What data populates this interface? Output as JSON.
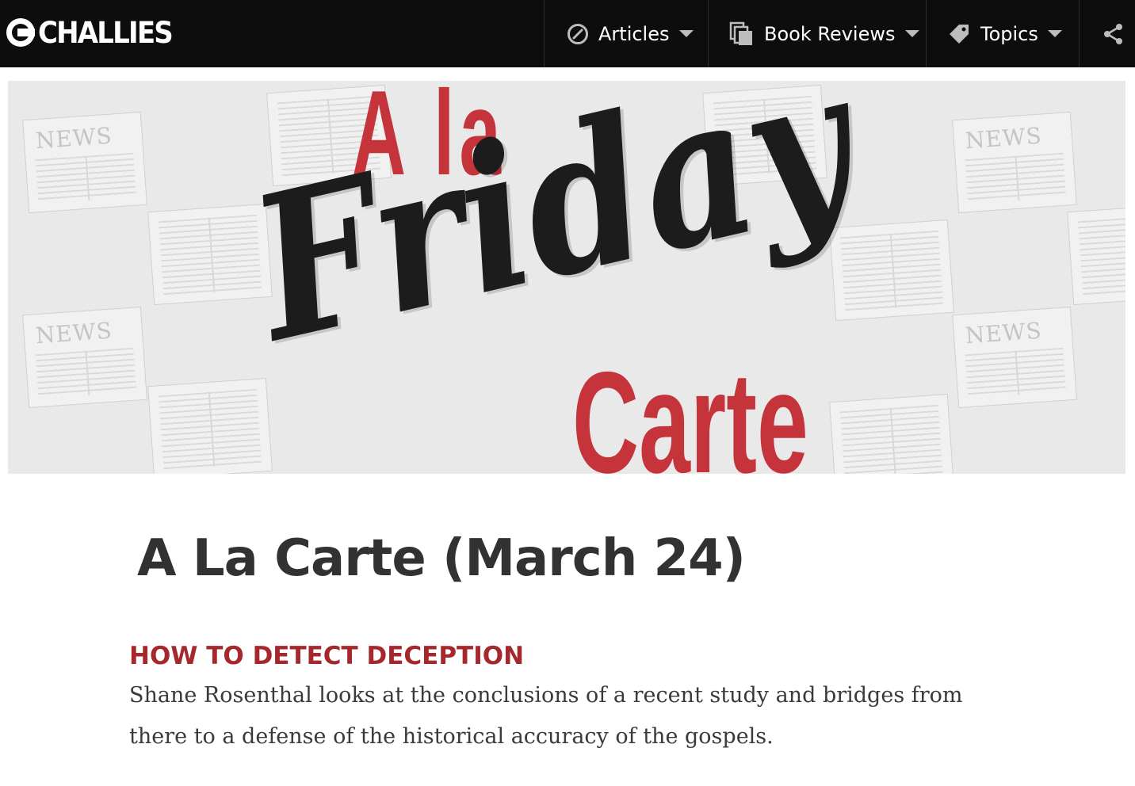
{
  "header": {
    "logo_text": "CHALLIES",
    "nav": {
      "articles_label": "Articles",
      "book_reviews_label": "Book Reviews",
      "topics_label": "Topics"
    }
  },
  "banner": {
    "top_text": "A la",
    "script_text": "Friday",
    "bottom_text": "Carte",
    "background_paper_heading": "NEWS",
    "colors": {
      "red": "#c5343a",
      "script": "#1c1c1c"
    }
  },
  "article": {
    "title": "A La Carte (March 24)",
    "section": {
      "heading": "HOW TO DETECT DECEPTION",
      "body": "Shane Rosenthal looks at the conclusions of a recent study and bridges from there to a defense of the historical accuracy of the gospels."
    }
  },
  "colors": {
    "header_bg": "#0d0d0e",
    "heading_red": "#a5282c",
    "title_text": "#323232"
  },
  "icons": {
    "articles": "compass-icon",
    "book_reviews": "books-icon",
    "topics": "tag-icon",
    "share": "share-icon",
    "caret": "chevron-down-icon"
  }
}
